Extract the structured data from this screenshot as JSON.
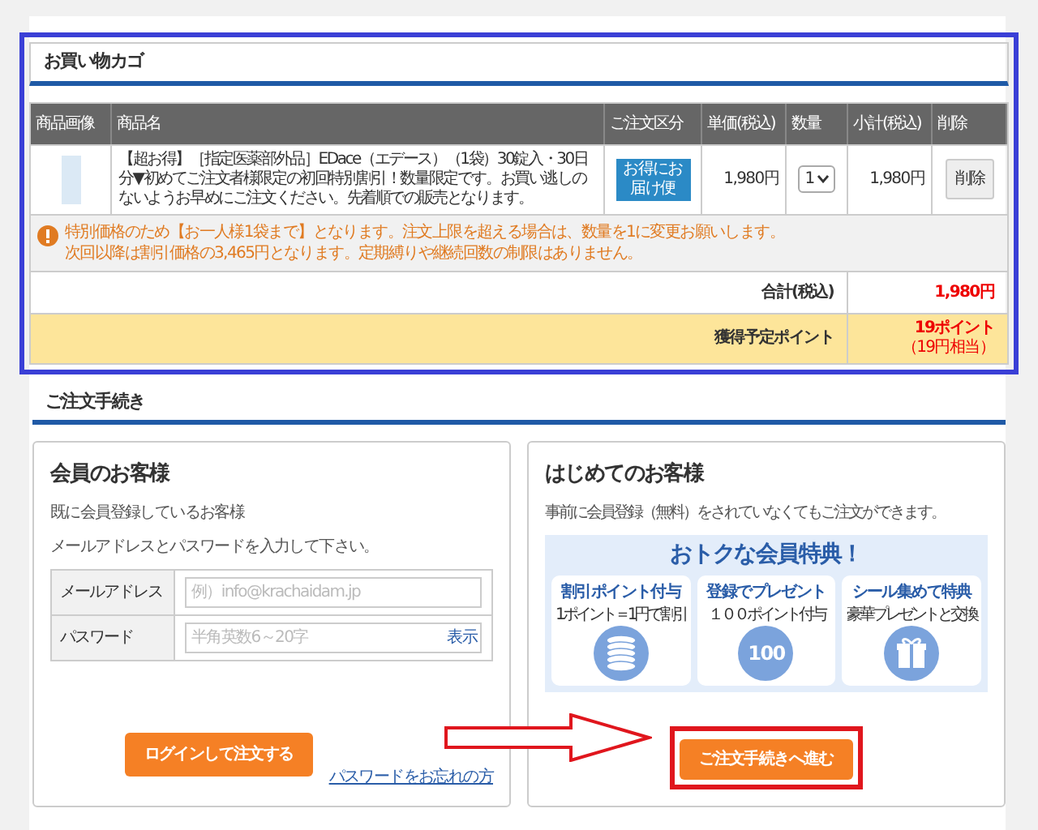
{
  "cart": {
    "title": "お買い物カゴ",
    "columns": [
      "商品画像",
      "商品名",
      "ご注文区分",
      "単価(税込)",
      "数量",
      "小計(税込)",
      "削除"
    ],
    "rows": [
      {
        "name": "【超お得】［指定医薬部外品］EDace（エデース）（1袋）30錠入・30日分▼初めてご注文者様限定の初回特別割引！数量限定です。お買い逃しのないようお早めにご注文ください。先着順での販売となります。",
        "order_type": "お得にお届け便",
        "unit_price": "1,980円",
        "quantity": "1",
        "subtotal": "1,980円",
        "delete": "削除"
      }
    ],
    "notice": [
      "特別価格のため【お一人様1袋まで】となります。注文上限を超える場合は、数量を1に変更お願いします。",
      "次回以降は割引価格の3,465円となります。定期縛りや継続回数の制限はありません。"
    ],
    "total_label": "合計(税込)",
    "total": "1,980円",
    "points_label": "獲得予定ポイント",
    "points": "19ポイント",
    "points_note": "（19円相当）"
  },
  "order": {
    "title": "ご注文手続き",
    "member": {
      "title": "会員のお客様",
      "lead": "既に会員登録しているお客様",
      "instruction": "メールアドレスとパスワードを入力して下さい。",
      "fields": [
        {
          "label": "メールアドレス",
          "placeholder": "例）info@krachaidam.jp"
        },
        {
          "label": "パスワード",
          "placeholder": "半角英数6～20字",
          "toggle": "表示"
        }
      ],
      "login": "ログインして注文する",
      "forgot": "パスワードをお忘れの方"
    },
    "guest": {
      "title": "はじめてのお客様",
      "lead": "事前に会員登録（無料）をされていなくてもご注文ができます。",
      "banner_title": "おトクな会員特典！",
      "benefits": [
        {
          "kind": "coins",
          "title": "割引ポイント付与",
          "sub": "1ポイント＝1円で割引"
        },
        {
          "kind": "number",
          "title": "登録でプレゼント",
          "sub": "１００ポイント付与",
          "badge": "100"
        },
        {
          "kind": "gift",
          "title": "シール集めて特典",
          "sub": "豪華プレゼントと交換"
        }
      ],
      "proceed": "ご注文手続きへ進む"
    }
  }
}
